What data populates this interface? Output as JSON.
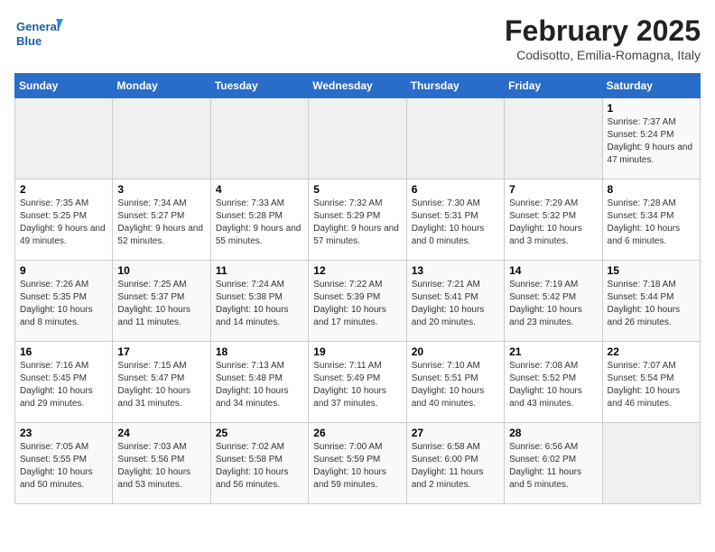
{
  "header": {
    "logo_line1": "General",
    "logo_line2": "Blue",
    "month": "February 2025",
    "location": "Codisotto, Emilia-Romagna, Italy"
  },
  "weekdays": [
    "Sunday",
    "Monday",
    "Tuesday",
    "Wednesday",
    "Thursday",
    "Friday",
    "Saturday"
  ],
  "weeks": [
    [
      {
        "day": "",
        "info": ""
      },
      {
        "day": "",
        "info": ""
      },
      {
        "day": "",
        "info": ""
      },
      {
        "day": "",
        "info": ""
      },
      {
        "day": "",
        "info": ""
      },
      {
        "day": "",
        "info": ""
      },
      {
        "day": "1",
        "info": "Sunrise: 7:37 AM\nSunset: 5:24 PM\nDaylight: 9 hours and 47 minutes."
      }
    ],
    [
      {
        "day": "2",
        "info": "Sunrise: 7:35 AM\nSunset: 5:25 PM\nDaylight: 9 hours and 49 minutes."
      },
      {
        "day": "3",
        "info": "Sunrise: 7:34 AM\nSunset: 5:27 PM\nDaylight: 9 hours and 52 minutes."
      },
      {
        "day": "4",
        "info": "Sunrise: 7:33 AM\nSunset: 5:28 PM\nDaylight: 9 hours and 55 minutes."
      },
      {
        "day": "5",
        "info": "Sunrise: 7:32 AM\nSunset: 5:29 PM\nDaylight: 9 hours and 57 minutes."
      },
      {
        "day": "6",
        "info": "Sunrise: 7:30 AM\nSunset: 5:31 PM\nDaylight: 10 hours and 0 minutes."
      },
      {
        "day": "7",
        "info": "Sunrise: 7:29 AM\nSunset: 5:32 PM\nDaylight: 10 hours and 3 minutes."
      },
      {
        "day": "8",
        "info": "Sunrise: 7:28 AM\nSunset: 5:34 PM\nDaylight: 10 hours and 6 minutes."
      }
    ],
    [
      {
        "day": "9",
        "info": "Sunrise: 7:26 AM\nSunset: 5:35 PM\nDaylight: 10 hours and 8 minutes."
      },
      {
        "day": "10",
        "info": "Sunrise: 7:25 AM\nSunset: 5:37 PM\nDaylight: 10 hours and 11 minutes."
      },
      {
        "day": "11",
        "info": "Sunrise: 7:24 AM\nSunset: 5:38 PM\nDaylight: 10 hours and 14 minutes."
      },
      {
        "day": "12",
        "info": "Sunrise: 7:22 AM\nSunset: 5:39 PM\nDaylight: 10 hours and 17 minutes."
      },
      {
        "day": "13",
        "info": "Sunrise: 7:21 AM\nSunset: 5:41 PM\nDaylight: 10 hours and 20 minutes."
      },
      {
        "day": "14",
        "info": "Sunrise: 7:19 AM\nSunset: 5:42 PM\nDaylight: 10 hours and 23 minutes."
      },
      {
        "day": "15",
        "info": "Sunrise: 7:18 AM\nSunset: 5:44 PM\nDaylight: 10 hours and 26 minutes."
      }
    ],
    [
      {
        "day": "16",
        "info": "Sunrise: 7:16 AM\nSunset: 5:45 PM\nDaylight: 10 hours and 29 minutes."
      },
      {
        "day": "17",
        "info": "Sunrise: 7:15 AM\nSunset: 5:47 PM\nDaylight: 10 hours and 31 minutes."
      },
      {
        "day": "18",
        "info": "Sunrise: 7:13 AM\nSunset: 5:48 PM\nDaylight: 10 hours and 34 minutes."
      },
      {
        "day": "19",
        "info": "Sunrise: 7:11 AM\nSunset: 5:49 PM\nDaylight: 10 hours and 37 minutes."
      },
      {
        "day": "20",
        "info": "Sunrise: 7:10 AM\nSunset: 5:51 PM\nDaylight: 10 hours and 40 minutes."
      },
      {
        "day": "21",
        "info": "Sunrise: 7:08 AM\nSunset: 5:52 PM\nDaylight: 10 hours and 43 minutes."
      },
      {
        "day": "22",
        "info": "Sunrise: 7:07 AM\nSunset: 5:54 PM\nDaylight: 10 hours and 46 minutes."
      }
    ],
    [
      {
        "day": "23",
        "info": "Sunrise: 7:05 AM\nSunset: 5:55 PM\nDaylight: 10 hours and 50 minutes."
      },
      {
        "day": "24",
        "info": "Sunrise: 7:03 AM\nSunset: 5:56 PM\nDaylight: 10 hours and 53 minutes."
      },
      {
        "day": "25",
        "info": "Sunrise: 7:02 AM\nSunset: 5:58 PM\nDaylight: 10 hours and 56 minutes."
      },
      {
        "day": "26",
        "info": "Sunrise: 7:00 AM\nSunset: 5:59 PM\nDaylight: 10 hours and 59 minutes."
      },
      {
        "day": "27",
        "info": "Sunrise: 6:58 AM\nSunset: 6:00 PM\nDaylight: 11 hours and 2 minutes."
      },
      {
        "day": "28",
        "info": "Sunrise: 6:56 AM\nSunset: 6:02 PM\nDaylight: 11 hours and 5 minutes."
      },
      {
        "day": "",
        "info": ""
      }
    ]
  ]
}
